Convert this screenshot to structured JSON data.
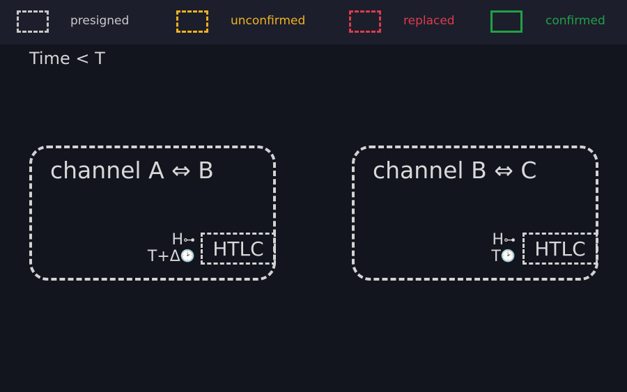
{
  "legend": {
    "items": [
      {
        "label": "presigned",
        "style": "dashed",
        "color": "#c8c8c8"
      },
      {
        "label": "unconfirmed",
        "style": "dashed",
        "color": "#f0b21e"
      },
      {
        "label": "replaced",
        "style": "dashed",
        "color": "#dc3c4a"
      },
      {
        "label": "confirmed",
        "style": "solid",
        "color": "#22a046"
      }
    ]
  },
  "time_label": "Time < T",
  "channels": [
    {
      "title": "channel A ⇔ B",
      "htlc_label": "HTLC",
      "hash_label": "H",
      "hash_icon": "key-icon",
      "time_label": "T+Δ",
      "time_icon": "clock-icon"
    },
    {
      "title": "channel B ⇔ C",
      "htlc_label": "HTLC",
      "hash_label": "H",
      "hash_icon": "key-icon",
      "time_label": "T",
      "time_icon": "clock-icon"
    }
  ]
}
